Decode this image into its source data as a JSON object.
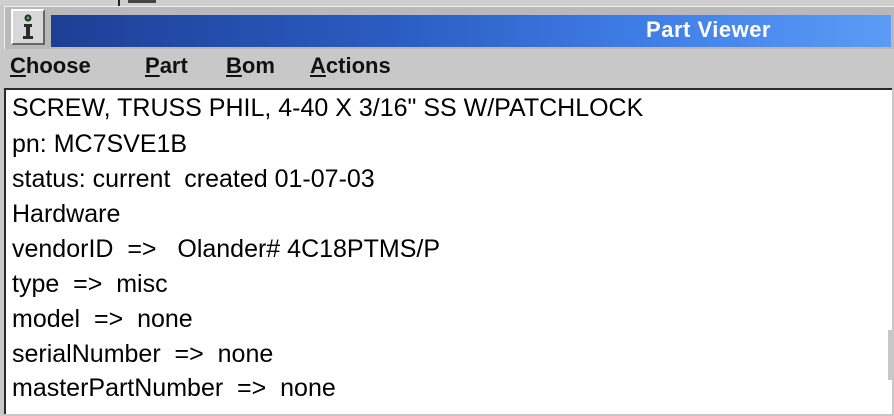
{
  "window": {
    "title": "Part Viewer",
    "colors": {
      "titlebar_start": "#1d3f96",
      "titlebar_end": "#5a9cf5",
      "content_bg": "#ffffff",
      "chrome_bg": "#c8c8c8"
    },
    "sys_menu_icon": "info-icon"
  },
  "menubar": {
    "items": [
      {
        "mnemonic": "C",
        "rest": "hoose"
      },
      {
        "mnemonic": "P",
        "rest": "art"
      },
      {
        "mnemonic": "B",
        "rest": "om"
      },
      {
        "mnemonic": "A",
        "rest": "ctions"
      }
    ]
  },
  "part": {
    "description": "SCREW, TRUSS PHIL, 4-40 X 3/16\" SS W/PATCHLOCK",
    "pn_line": "pn: MC7SVE1B",
    "status_line": "status: current  created 01-07-03",
    "category": "Hardware",
    "vendor_line": "vendorID  =>   Olander# 4C18PTMS/P",
    "type_line": "type  =>  misc",
    "model_line": "model  =>  none",
    "serial_line": "serialNumber  =>  none",
    "master_line": "masterPartNumber  =>  none"
  }
}
